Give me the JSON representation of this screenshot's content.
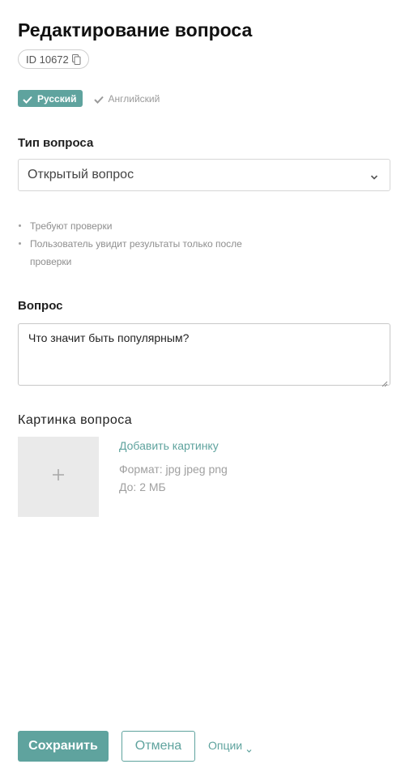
{
  "header": {
    "title": "Редактирование вопроса",
    "id_chip": "ID 10672"
  },
  "languages": {
    "active": "Русский",
    "inactive": "Английский"
  },
  "question_type": {
    "label": "Тип вопроса",
    "selected": "Открытый вопрос",
    "notes": [
      "Требуют проверки",
      "Пользователь увидит результаты только после проверки"
    ]
  },
  "question": {
    "label": "Вопрос",
    "value": "Что значит быть популярным?"
  },
  "image": {
    "label": "Картинка вопроса",
    "add_link": "Добавить картинку",
    "format": "Формат: jpg  jpeg  png",
    "size": "До: 2 МБ"
  },
  "footer": {
    "save_label": "Сохранить",
    "cancel_label": "Отмена",
    "options_label": "Опции"
  },
  "colors": {
    "accent": "#5fa39e"
  }
}
